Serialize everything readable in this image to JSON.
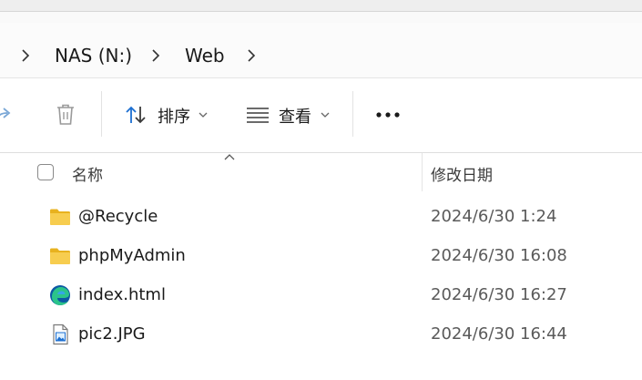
{
  "breadcrumb": {
    "items": [
      {
        "label": "NAS (N:)"
      },
      {
        "label": "Web"
      }
    ]
  },
  "toolbar": {
    "share_icon": "share-icon",
    "delete_icon": "trash-icon",
    "sort_label": "排序",
    "view_label": "查看",
    "more_label": "•••"
  },
  "columns": {
    "name": "名称",
    "modified": "修改日期"
  },
  "files": [
    {
      "name": "@Recycle",
      "modified": "2024/6/30 1:24",
      "icon": "folder-icon"
    },
    {
      "name": "phpMyAdmin",
      "modified": "2024/6/30 16:08",
      "icon": "folder-icon"
    },
    {
      "name": "index.html",
      "modified": "2024/6/30 16:27",
      "icon": "edge-html-icon"
    },
    {
      "name": "pic2.JPG",
      "modified": "2024/6/30 16:44",
      "icon": "image-file-icon"
    }
  ],
  "colors": {
    "folder": "#f4c542",
    "accent": "#1c6fd1"
  }
}
